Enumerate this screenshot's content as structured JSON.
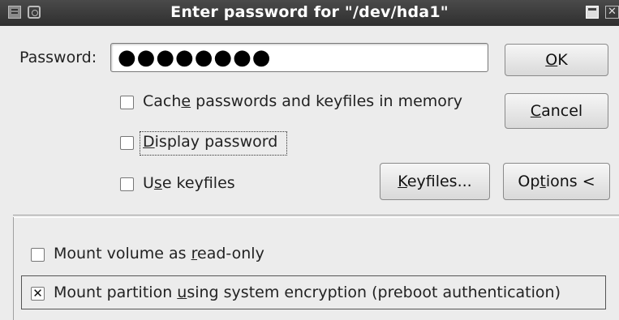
{
  "window": {
    "title": "Enter password for \"/dev/hda1\""
  },
  "password": {
    "label_prefix": "Password:",
    "value": "●●●●●●●●"
  },
  "buttons": {
    "ok_mnemonic": "O",
    "ok_rest": "K",
    "cancel_mnemonic": "C",
    "cancel_rest": "ancel",
    "keyfiles_mnemonic": "K",
    "keyfiles_rest": "eyfiles...",
    "options_pre": "Op",
    "options_mnemonic": "t",
    "options_rest": "ions <"
  },
  "options": {
    "cache": {
      "pre": "Cach",
      "mnemonic": "e",
      "rest": " passwords and keyfiles in memory",
      "checked": false
    },
    "display": {
      "mnemonic": "D",
      "rest": "isplay password",
      "checked": false
    },
    "use_keyfiles": {
      "pre": "U",
      "mnemonic": "s",
      "rest": "e keyfiles",
      "checked": false
    },
    "read_only": {
      "pre": "Mount volume as ",
      "mnemonic": "r",
      "rest": "ead-only",
      "checked": false
    },
    "system_encryption": {
      "pre": "Mount partition ",
      "mnemonic": "u",
      "rest": "sing system encryption (preboot authentication)",
      "checked": true
    }
  }
}
